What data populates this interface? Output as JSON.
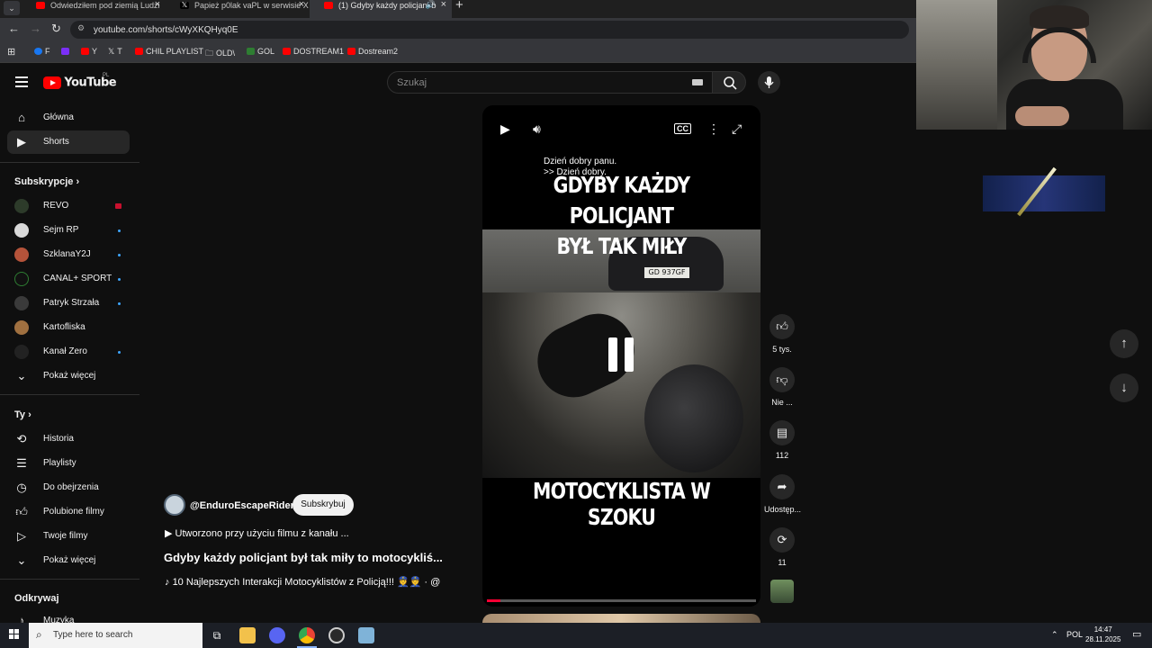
{
  "browser": {
    "tabs": [
      {
        "title": "Odwiedziłem pod ziemią Ludzi",
        "favicon_color": "#ff0000"
      },
      {
        "title": "Papież p0lak vaPL w serwisie X",
        "favicon_color": "#000000"
      },
      {
        "title": "(1) Gdyby każdy policjant b",
        "favicon_color": "#ff0000",
        "active": true
      }
    ],
    "url": "youtube.com/shorts/cWyXKQHyq0E",
    "bookmarks": [
      {
        "label": "F",
        "color": "#1877f2"
      },
      {
        "label": "",
        "color": "#7b2ff7"
      },
      {
        "label": "Y",
        "color": "#ff0000"
      },
      {
        "label": "T",
        "color": "#000000"
      },
      {
        "label": "CHIL PLAYLIST",
        "color": "#ff0000"
      },
      {
        "label": "OLD\\",
        "color": "#999999"
      },
      {
        "label": "GOL",
        "color": "#2e7d32"
      },
      {
        "label": "DOSTREAM1",
        "color": "#ff0000"
      },
      {
        "label": "Dostream2",
        "color": "#ff0000"
      }
    ]
  },
  "header": {
    "logo_text": "YouTube",
    "country_code": "PL",
    "search_placeholder": "Szukaj"
  },
  "sidebar": {
    "main": [
      {
        "label": "Główna",
        "icon": "home-icon"
      },
      {
        "label": "Shorts",
        "icon": "shorts-icon",
        "active": true
      }
    ],
    "subscriptions_title": "Subskrypcje",
    "subscriptions": [
      {
        "label": "REVO",
        "avatar_color": "#2d3b2a",
        "live": true
      },
      {
        "label": "Sejm RP",
        "avatar_color": "#d9d9d9",
        "new": true
      },
      {
        "label": "SzklanaY2J",
        "avatar_color": "#b5533a",
        "new": true
      },
      {
        "label": "CANAL+ SPORT",
        "avatar_color": "#111111",
        "new": true
      },
      {
        "label": "Patryk Strzała",
        "avatar_color": "#3a3a3a",
        "new": true
      },
      {
        "label": "Kartofliska",
        "avatar_color": "#a07040",
        "new": false
      },
      {
        "label": "Kanał Zero",
        "avatar_color": "#222222",
        "new": true
      }
    ],
    "show_more": "Pokaż więcej",
    "you_title": "Ty",
    "you_items": [
      {
        "label": "Historia",
        "icon": "history-icon"
      },
      {
        "label": "Playlisty",
        "icon": "playlists-icon"
      },
      {
        "label": "Do obejrzenia",
        "icon": "watch-later-icon"
      },
      {
        "label": "Polubione filmy",
        "icon": "liked-icon"
      },
      {
        "label": "Twoje filmy",
        "icon": "your-videos-icon"
      },
      {
        "label": "Pokaż więcej",
        "icon": "chevron-down-icon"
      }
    ],
    "explore_title": "Odkrywaj",
    "explore_items": [
      {
        "label": "Muzyka",
        "icon": "music-icon"
      }
    ]
  },
  "short": {
    "subtitle_line1": "Dzień dobry panu.",
    "subtitle_line2": ">> Dzień dobry.",
    "caption_top_1": "GDYBY KAŻDY POLICJANT",
    "caption_top_2": "BYŁ TAK MIŁY",
    "caption_bottom": "MOTOCYKLISTA W SZOKU",
    "plate": "GD 937GF",
    "progress_fraction": 0.05,
    "channel": "@EnduroEscapeRiders",
    "subscribe_label": "Subskrybuj",
    "created_with": "Utworzono przy użyciu filmu z kanału ...",
    "title": "Gdyby każdy policjant był tak miły to motocykliś...",
    "music": "10 Najlepszych Interakcji Motocyklistów z Policją!!! 👮👮 · @"
  },
  "actions": {
    "likes": "5 tys.",
    "dislike": "Nie ...",
    "comments": "112",
    "share": "Udostęp...",
    "remix": "11"
  },
  "taskbar": {
    "search_placeholder": "Type here to search",
    "lang": "POL",
    "time": "14:47",
    "date": "28.11.2025"
  },
  "colors": {
    "background": "#0f0f0f",
    "accent_red": "#ff0000",
    "progress": "#ff0033"
  }
}
